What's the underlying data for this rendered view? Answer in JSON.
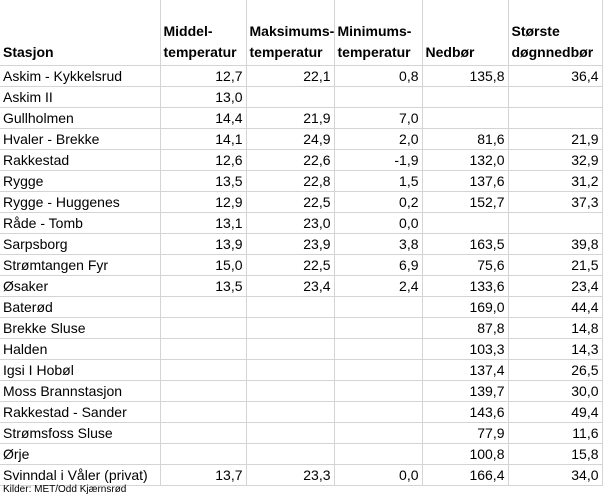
{
  "table": {
    "headers": [
      "Stasjon",
      "Middel-temperatur",
      "Maksimums-temperatur",
      "Minimums-temperatur",
      "Nedbør",
      "Største døgnnedbør"
    ],
    "rows": [
      [
        "Askim - Kykkelsrud",
        "12,7",
        "22,1",
        "0,8",
        "135,8",
        "36,4"
      ],
      [
        "Askim II",
        "13,0",
        "",
        "",
        "",
        ""
      ],
      [
        "Gullholmen",
        "14,4",
        "21,9",
        "7,0",
        "",
        ""
      ],
      [
        "Hvaler - Brekke",
        "14,1",
        "24,9",
        "2,0",
        "81,6",
        "21,9"
      ],
      [
        "Rakkestad",
        "12,6",
        "22,6",
        "-1,9",
        "132,0",
        "32,9"
      ],
      [
        "Rygge",
        "13,5",
        "22,8",
        "1,5",
        "137,6",
        "31,2"
      ],
      [
        "Rygge - Huggenes",
        "12,9",
        "22,5",
        "0,2",
        "152,7",
        "37,3"
      ],
      [
        "Råde - Tomb",
        "13,1",
        "23,0",
        "0,0",
        "",
        ""
      ],
      [
        "Sarpsborg",
        "13,9",
        "23,9",
        "3,8",
        "163,5",
        "39,8"
      ],
      [
        "Strømtangen Fyr",
        "15,0",
        "22,5",
        "6,9",
        "75,6",
        "21,5"
      ],
      [
        "Øsaker",
        "13,5",
        "23,4",
        "2,4",
        "133,6",
        "23,4"
      ],
      [
        "Baterød",
        "",
        "",
        "",
        "169,0",
        "44,4"
      ],
      [
        "Brekke Sluse",
        "",
        "",
        "",
        "87,8",
        "14,8"
      ],
      [
        "Halden",
        "",
        "",
        "",
        "103,3",
        "14,3"
      ],
      [
        "Igsi I Hobøl",
        "",
        "",
        "",
        "137,4",
        "26,5"
      ],
      [
        "Moss Brannstasjon",
        "",
        "",
        "",
        "139,7",
        "30,0"
      ],
      [
        "Rakkestad - Sander",
        "",
        "",
        "",
        "143,6",
        "49,4"
      ],
      [
        "Strømsfoss Sluse",
        "",
        "",
        "",
        "77,9",
        "11,6"
      ],
      [
        "Ørje",
        "",
        "",
        "",
        "100,8",
        "15,8"
      ],
      [
        "Svinndal i Våler (privat)",
        "13,7",
        "23,3",
        "0,0",
        "166,4",
        "34,0"
      ]
    ]
  },
  "footer": {
    "source": "Kilder: MET/Odd Kjærnsrød"
  }
}
